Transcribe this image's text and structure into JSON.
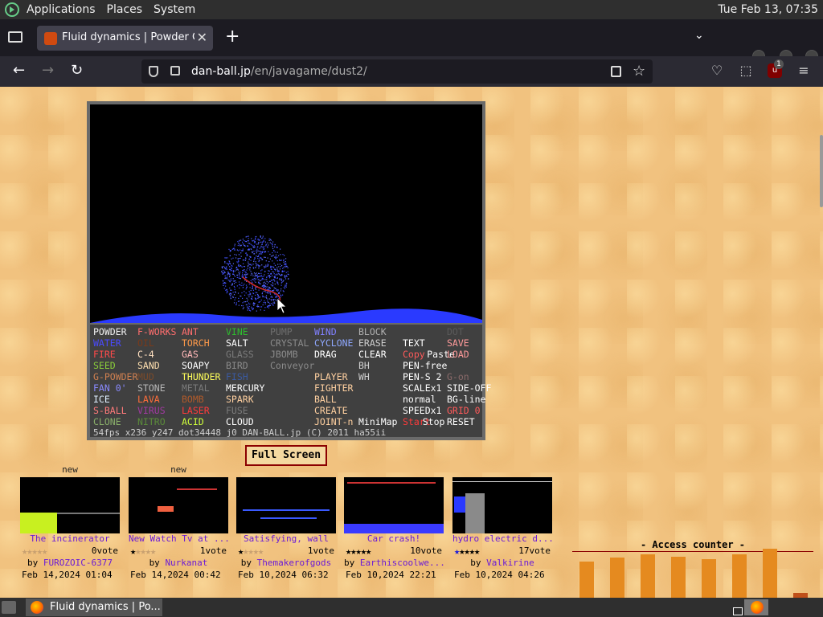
{
  "panel": {
    "applications": "Applications",
    "places": "Places",
    "system": "System",
    "clock": "Tue Feb 13, 07:35"
  },
  "browser": {
    "tab_title": "Fluid dynamics | Powder Game",
    "url_host": "dan-ball.jp",
    "url_path": "/en/javagame/dust2/",
    "extension_badge": "1"
  },
  "game": {
    "elements": [
      {
        "label": "POWDER",
        "color": "#f0f0f0"
      },
      {
        "label": "F-WORKS",
        "color": "#ff6e6e"
      },
      {
        "label": "ANT",
        "color": "#ff6e6e"
      },
      {
        "label": "VINE",
        "color": "#2dbd2d"
      },
      {
        "label": "PUMP",
        "color": "#6e6e6e"
      },
      {
        "label": "WIND",
        "color": "#8080ff"
      },
      {
        "label": "BLOCK",
        "color": "#b0b0b0"
      },
      {
        "label": "DOT",
        "color": "#5a5a5a"
      },
      {
        "label": "WATER",
        "color": "#4a4aff"
      },
      {
        "label": "OIL",
        "color": "#7a3a1a"
      },
      {
        "label": "TORCH",
        "color": "#ff9a4a"
      },
      {
        "label": "SALT",
        "color": "#ffffff"
      },
      {
        "label": "CRYSTAL",
        "color": "#8a8a8a"
      },
      {
        "label": "CYCLONE",
        "color": "#8fa8ff"
      },
      {
        "label": "ERASE",
        "color": "#cfcfcf"
      },
      {
        "label": "TEXT",
        "color": "#ffffff"
      },
      {
        "label": "SAVE",
        "color": "#ff9a9a"
      },
      {
        "label": "FIRE",
        "color": "#ff4a4a"
      },
      {
        "label": "C-4",
        "color": "#ffe0c0"
      },
      {
        "label": "GAS",
        "color": "#ffb8b8"
      },
      {
        "label": "GLASS",
        "color": "#7a7a7a"
      },
      {
        "label": "JBOMB",
        "color": "#8a8a8a"
      },
      {
        "label": "DRAG",
        "color": "#ffffff"
      },
      {
        "label": "CLEAR",
        "color": "#ffffff"
      },
      {
        "label": "Copy",
        "color": "#ff5a5a"
      },
      {
        "label": "Paste",
        "color": "#ffffff"
      },
      {
        "label": "LOAD",
        "color": "#ff9a9a"
      },
      {
        "label": "SEED",
        "color": "#8acd3a"
      },
      {
        "label": "SAND",
        "color": "#ffe0b0"
      },
      {
        "label": "SOAPY",
        "color": "#ffffff"
      },
      {
        "label": "BIRD",
        "color": "#8a8a8a"
      },
      {
        "label": "Conveyor",
        "color": "#8a8a8a"
      },
      {
        "label": "BH",
        "color": "#cfcfcf"
      },
      {
        "label": "PEN-free",
        "color": "#ffffff"
      },
      {
        "label": "G-POWDER",
        "color": "#d08050"
      },
      {
        "label": "MUD",
        "color": "#7a4a2a"
      },
      {
        "label": "THUNDER",
        "color": "#ffff5a"
      },
      {
        "label": "FISH",
        "color": "#3a5aa0"
      },
      {
        "label": "PLAYER",
        "color": "#ffd0a0"
      },
      {
        "label": "WH",
        "color": "#cfcfcf"
      },
      {
        "label": "PEN-S 2",
        "color": "#ffffff"
      },
      {
        "label": "G-on",
        "color": "#8a6a6a"
      },
      {
        "label": "FAN 0'",
        "color": "#8a8aff"
      },
      {
        "label": "STONE",
        "color": "#b8b8b8"
      },
      {
        "label": "METAL",
        "color": "#7a7a7a"
      },
      {
        "label": "MERCURY",
        "color": "#ffffff"
      },
      {
        "label": "FIGHTER",
        "color": "#ffd0a0"
      },
      {
        "label": "SCALEx1",
        "color": "#ffffff"
      },
      {
        "label": "SIDE-OFF",
        "color": "#ffffff"
      },
      {
        "label": "ICE",
        "color": "#e0f0ff"
      },
      {
        "label": "LAVA",
        "color": "#ff6e3a"
      },
      {
        "label": "BOMB",
        "color": "#b05a2a"
      },
      {
        "label": "SPARK",
        "color": "#ffd0a0"
      },
      {
        "label": "BALL",
        "color": "#ffd0a0"
      },
      {
        "label": "normal",
        "color": "#ffffff"
      },
      {
        "label": "BG-line",
        "color": "#ffffff"
      },
      {
        "label": "S-BALL",
        "color": "#ff7a7a"
      },
      {
        "label": "VIRUS",
        "color": "#a03aa0"
      },
      {
        "label": "LASER",
        "color": "#ff3a3a"
      },
      {
        "label": "FUSE",
        "color": "#7a7a7a"
      },
      {
        "label": "CREATE",
        "color": "#ffd0a0"
      },
      {
        "label": "SPEEDx1",
        "color": "#ffffff"
      },
      {
        "label": "GRID 0",
        "color": "#ff5a5a"
      },
      {
        "label": "CLONE",
        "color": "#8ab06a"
      },
      {
        "label": "NITRO",
        "color": "#5a8a3a"
      },
      {
        "label": "ACID",
        "color": "#cfff3a"
      },
      {
        "label": "CLOUD",
        "color": "#ffffff"
      },
      {
        "label": "JOINT-n",
        "color": "#ffd0a0"
      },
      {
        "label": "MiniMap",
        "color": "#ffffff"
      },
      {
        "label": "Start",
        "color": "#ff3a3a"
      },
      {
        "label": "Stop",
        "color": "#ffffff"
      },
      {
        "label": "RESET",
        "color": "#ffffff"
      }
    ],
    "status": "54fps x236 y247 dot34448 j0 DAN-BALL.jp (C) 2011 ha55ii",
    "full_screen_label": "Full Screen"
  },
  "thumbnails": [
    {
      "badge": "new",
      "name": "The incinerator",
      "stars_on": 0,
      "stars_blue": 0,
      "votes": "0vote",
      "by_prefix": "by",
      "author": "FUROZOIC-6377",
      "date": "Feb 14,2024 01:04"
    },
    {
      "badge": "new",
      "name": "New Watch Tv at ...",
      "stars_on": 1,
      "stars_blue": 0,
      "votes": "1vote",
      "by_prefix": "by",
      "author": "Nurkanat",
      "date": "Feb 14,2024 00:42"
    },
    {
      "badge": "",
      "name": "Satisfying, wall",
      "stars_on": 1,
      "stars_blue": 0,
      "votes": "1vote",
      "by_prefix": "by",
      "author": "Themakerofgods",
      "date": "Feb 10,2024 06:32"
    },
    {
      "badge": "",
      "name": "Car crash!",
      "stars_on": 5,
      "stars_blue": 0,
      "votes": "10vote",
      "by_prefix": "by",
      "author": "Earthiscoolwe...",
      "date": "Feb 10,2024 22:21"
    },
    {
      "badge": "",
      "name": "hydro electric d...",
      "stars_on": 4,
      "stars_blue": 1,
      "votes": "17vote",
      "by_prefix": "by",
      "author": "Valkirine",
      "date": "Feb 10,2024 04:26"
    }
  ],
  "access_counter": {
    "title": "- Access counter -",
    "bar_levels": [
      0.56,
      0.62,
      0.68,
      0.64,
      0.6,
      0.68,
      0.76,
      0.08
    ]
  },
  "taskbar": {
    "window_title": "Fluid dynamics | Po..."
  }
}
